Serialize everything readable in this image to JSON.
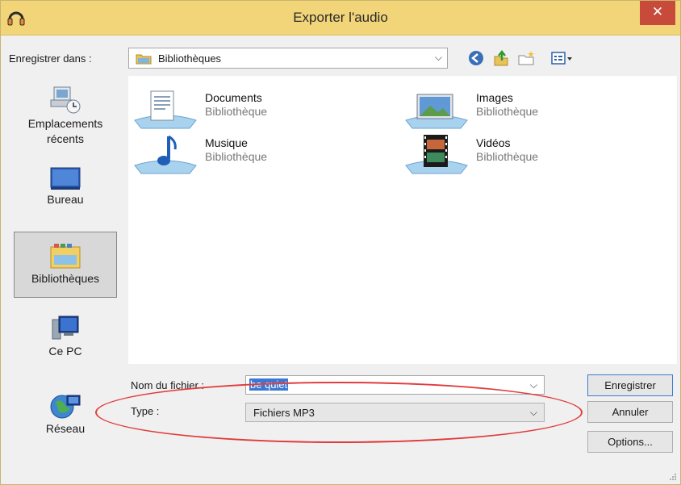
{
  "window": {
    "title": "Exporter l'audio",
    "close_glyph": "✕"
  },
  "toolbar": {
    "save_in_label": "Enregistrer dans :",
    "location": "Bibliothèques",
    "dropdown_glyph": "⌵"
  },
  "places": [
    {
      "label_line1": "Emplacements",
      "label_line2": "récents"
    },
    {
      "label_line1": "Bureau"
    },
    {
      "label_line1": "Bibliothèques"
    },
    {
      "label_line1": "Ce PC"
    },
    {
      "label_line1": "Réseau"
    }
  ],
  "libraries": [
    {
      "name": "Documents",
      "type": "Bibliothèque"
    },
    {
      "name": "Images",
      "type": "Bibliothèque"
    },
    {
      "name": "Musique",
      "type": "Bibliothèque"
    },
    {
      "name": "Vidéos",
      "type": "Bibliothèque"
    }
  ],
  "form": {
    "filename_label": "Nom du fichier :",
    "filename_value": "be quiet",
    "type_label": "Type :",
    "type_value": "Fichiers MP3"
  },
  "buttons": {
    "save": "Enregistrer",
    "cancel": "Annuler",
    "options": "Options..."
  },
  "colors": {
    "titlebar": "#f2d479",
    "close": "#c74a3a",
    "annotation": "#e13b3b",
    "selection": "#3b78d4"
  }
}
